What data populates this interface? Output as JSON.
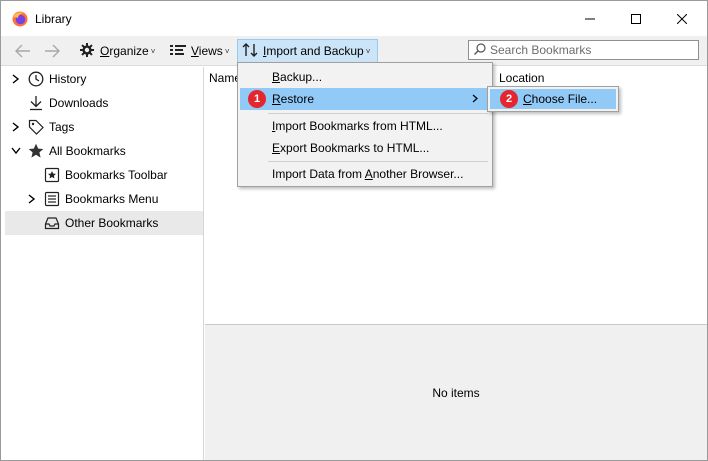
{
  "window": {
    "title": "Library"
  },
  "toolbar": {
    "organize": {
      "prefix": "",
      "accel": "O",
      "rest": "rganize"
    },
    "views": {
      "prefix": "",
      "accel": "V",
      "rest": "iews"
    },
    "import_backup": {
      "prefix": "",
      "accel": "I",
      "rest": "mport and Backup"
    },
    "search_placeholder": "Search Bookmarks"
  },
  "sidebar": {
    "items": [
      {
        "label": "History",
        "icon": "clock-icon",
        "expandable": true
      },
      {
        "label": "Downloads",
        "icon": "download-icon",
        "expandable": false
      },
      {
        "label": "Tags",
        "icon": "tag-icon",
        "expandable": true
      },
      {
        "label": "All Bookmarks",
        "icon": "star-icon",
        "expandable": true,
        "expanded": true
      },
      {
        "label": "Bookmarks Toolbar",
        "icon": "bookmarks-toolbar-icon",
        "expandable": false
      },
      {
        "label": "Bookmarks Menu",
        "icon": "bookmarks-menu-icon",
        "expandable": true
      },
      {
        "label": "Other Bookmarks",
        "icon": "inbox-icon",
        "expandable": false,
        "selected": true
      }
    ]
  },
  "columns": {
    "name": "Name",
    "location": "Location"
  },
  "details": {
    "empty_text": "No items"
  },
  "menu": {
    "items": [
      {
        "accel": "B",
        "rest": "ackup..."
      },
      {
        "accel": "R",
        "rest": "estore"
      },
      {
        "accel": "I",
        "rest": "mport Bookmarks from HTML..."
      },
      {
        "accel": "E",
        "rest": "xport Bookmarks to HTML..."
      },
      {
        "prefix": "Import Data from ",
        "accel": "A",
        "rest": "nother Browser..."
      }
    ]
  },
  "submenu": {
    "item": {
      "accel": "C",
      "rest": "hoose File..."
    }
  },
  "badges": [
    "1",
    "2"
  ],
  "colors": {
    "highlight": "#91c9f7",
    "toolbar_active": "#cce4f7",
    "badge": "#e4262f",
    "toolbar_bg": "#f0f0f0"
  }
}
